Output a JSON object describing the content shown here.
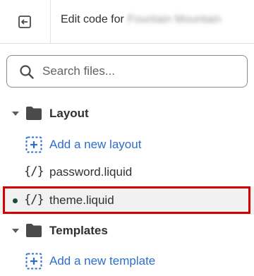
{
  "header": {
    "exit_icon": "exit-editor-icon",
    "title_prefix": "Edit code for",
    "store_name": "Fountain Mountain"
  },
  "search": {
    "placeholder": "Search files..."
  },
  "tree": {
    "layout_folder": {
      "label": "Layout",
      "expanded": true
    },
    "add_layout": {
      "label": "Add a new layout"
    },
    "password_file": {
      "label": "password.liquid",
      "icon": "{/}"
    },
    "theme_file": {
      "label": "theme.liquid",
      "icon": "{/}",
      "selected": true
    },
    "templates_folder": {
      "label": "Templates",
      "expanded": true
    },
    "add_template": {
      "label": "Add a new template"
    }
  },
  "colors": {
    "link": "#2c6ecb",
    "highlight": "#d00000",
    "active_dot": "#1a4d3a"
  }
}
